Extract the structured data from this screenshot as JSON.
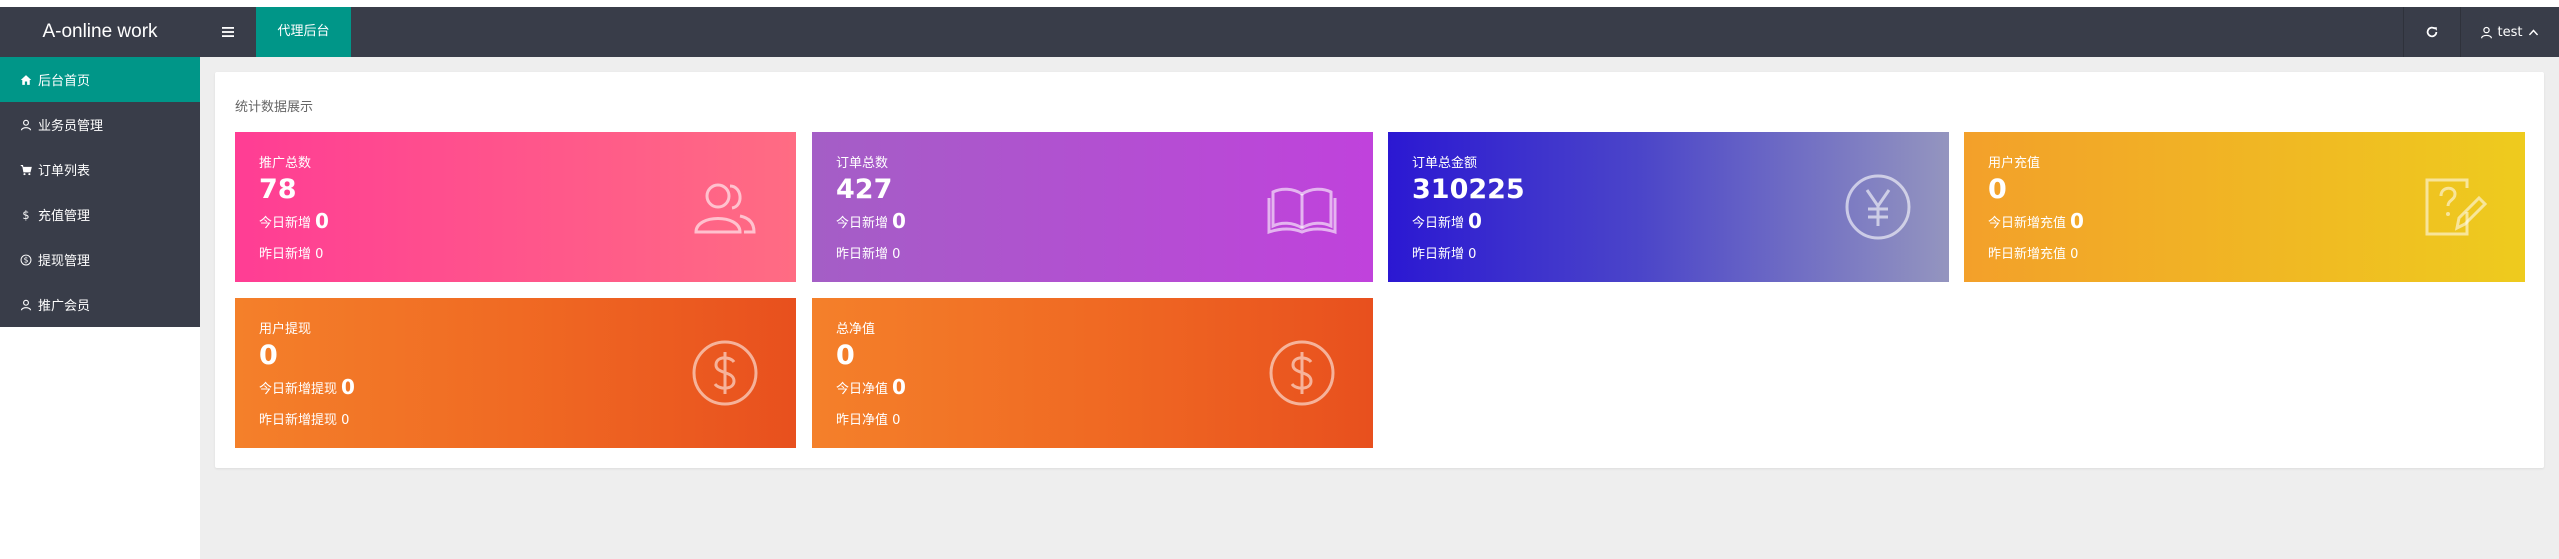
{
  "header": {
    "logo": "A-online work",
    "menu_icon": "hamburger-icon",
    "active_tab": "代理后台",
    "refresh_icon": "refresh-icon",
    "user_name": "test"
  },
  "sidebar": {
    "items": [
      {
        "label": "后台首页",
        "icon": "home-icon",
        "active": true
      },
      {
        "label": "业务员管理",
        "icon": "user-icon",
        "active": false
      },
      {
        "label": "订单列表",
        "icon": "cart-icon",
        "active": false
      },
      {
        "label": "充值管理",
        "icon": "dollar-icon",
        "active": false
      },
      {
        "label": "提现管理",
        "icon": "coin-icon",
        "active": false
      },
      {
        "label": "推广会员",
        "icon": "user-icon",
        "active": false
      }
    ]
  },
  "main": {
    "panel_title": "统计数据展示",
    "cards": [
      {
        "title": "推广总数",
        "value": "78",
        "today_label": "今日新增",
        "today_value": "0",
        "yesterday_label": "昨日新增",
        "yesterday_value": "0",
        "icon": "users-icon"
      },
      {
        "title": "订单总数",
        "value": "427",
        "today_label": "今日新增",
        "today_value": "0",
        "yesterday_label": "昨日新增",
        "yesterday_value": "0",
        "icon": "book-icon"
      },
      {
        "title": "订单总金额",
        "value": "310225",
        "today_label": "今日新增",
        "today_value": "0",
        "yesterday_label": "昨日新增",
        "yesterday_value": "0",
        "icon": "yen-icon"
      },
      {
        "title": "用户充值",
        "value": "0",
        "today_label": "今日新增充值",
        "today_value": "0",
        "yesterday_label": "昨日新增充值",
        "yesterday_value": "0",
        "icon": "edit-icon"
      },
      {
        "title": "用户提现",
        "value": "0",
        "today_label": "今日新增提现",
        "today_value": "0",
        "yesterday_label": "昨日新增提现",
        "yesterday_value": "0",
        "icon": "dollar-circle-icon"
      },
      {
        "title": "总净值",
        "value": "0",
        "today_label": "今日净值",
        "today_value": "0",
        "yesterday_label": "昨日净值",
        "yesterday_value": "0",
        "icon": "dollar-circle-icon"
      }
    ]
  },
  "colors": {
    "header_bg": "#393d49",
    "accent": "#009688",
    "page_bg": "#eeeeee"
  }
}
